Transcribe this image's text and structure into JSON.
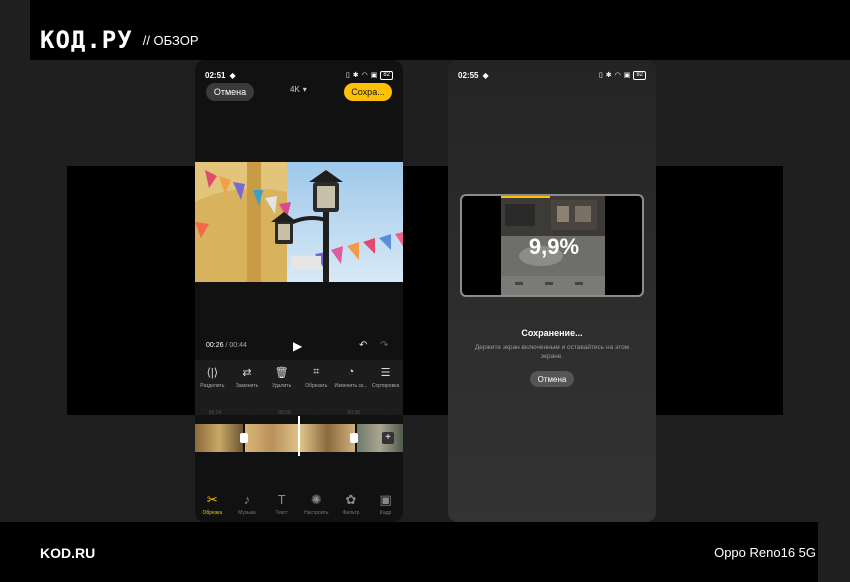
{
  "header": {
    "logo": "КОД.РУ",
    "subtitle": "// ОБЗОР"
  },
  "footer": {
    "site": "KOD.RU",
    "device": "Oppo Reno16 5G"
  },
  "left_phone": {
    "status_time": "02:51",
    "battery": "82",
    "cancel_label": "Отмена",
    "resolution": "4K",
    "save_label": "Сохра...",
    "time_current": "00:26",
    "time_separator": " / ",
    "time_total": "00:44",
    "tools": [
      {
        "label": "Разделить",
        "icon": "split-icon"
      },
      {
        "label": "Заменить",
        "icon": "replace-icon"
      },
      {
        "label": "Удалить",
        "icon": "trash-icon"
      },
      {
        "label": "Обрезать",
        "icon": "crop-icon"
      },
      {
        "label": "Изменить ск...",
        "icon": "speed-icon"
      },
      {
        "label": "Сортировка",
        "icon": "sort-icon"
      }
    ],
    "ruler": [
      "00:24",
      "·",
      "00:26",
      "·",
      "00:28",
      "·"
    ],
    "nav": [
      {
        "label": "Обрезка",
        "icon": "scissors-icon",
        "active": true
      },
      {
        "label": "Музыка",
        "icon": "music-icon",
        "active": false
      },
      {
        "label": "Текст",
        "icon": "text-icon",
        "active": false
      },
      {
        "label": "Настроить",
        "icon": "adjust-icon",
        "active": false
      },
      {
        "label": "Фильтр",
        "icon": "filter-icon",
        "active": false
      },
      {
        "label": "Кадр",
        "icon": "frame-icon",
        "active": false
      }
    ],
    "accent_color": "#ffc107"
  },
  "right_phone": {
    "status_time": "02:55",
    "battery": "82",
    "progress_text": "9,9%",
    "progress_fraction": 0.099,
    "saving_title": "Сохранение...",
    "saving_hint": "Держите экран включенным и оставайтесь на этом экране.",
    "cancel_label": "Отмена"
  }
}
